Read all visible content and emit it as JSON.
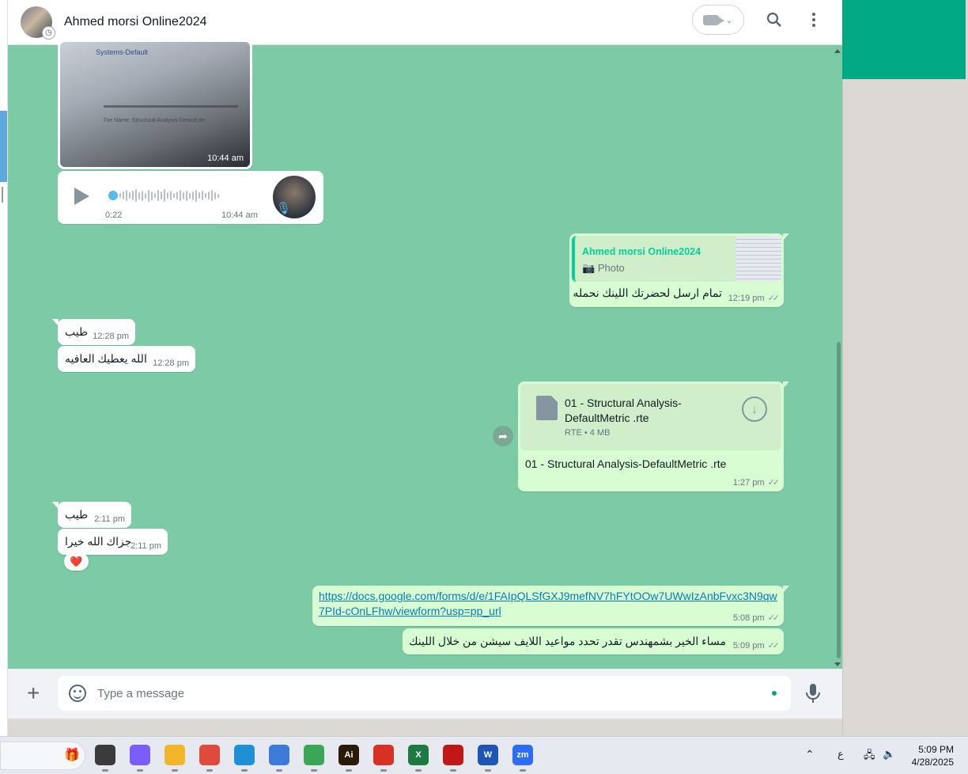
{
  "header": {
    "contact_name": "Ahmed morsi Online2024"
  },
  "messages": {
    "photo": {
      "time": "10:44 am",
      "screen_label": "Systems-Default",
      "screen_text": "File Name:  Structural Analysis-Default.rte"
    },
    "voice": {
      "duration": "0:22",
      "time": "10:44 am"
    },
    "reply": {
      "quoted_name": "Ahmed morsi Online2024",
      "quoted_type": "Photo",
      "text": "تمام ارسل لحضرتك اللينك نحمله",
      "time": "12:19 pm"
    },
    "in1": {
      "text": "طيب",
      "time": "12:28 pm"
    },
    "in2": {
      "text": "الله يعطيك العافيه",
      "time": "12:28 pm"
    },
    "file": {
      "name": "01 - Structural Analysis-DefaultMetric .rte",
      "meta": "RTE • 4 MB",
      "caption": "01 - Structural Analysis-DefaultMetric .rte",
      "time": "1:27 pm"
    },
    "in3": {
      "text": "طيب",
      "time": "2:11 pm"
    },
    "in4": {
      "text": "جزاك الله خيرا",
      "time": "2:11 pm",
      "reaction": "❤️"
    },
    "link": {
      "url": "https://docs.google.com/forms/d/e/1FAIpQLSfGXJ9mefNV7hFYtOOw7UWwIzAnbFvxc3N9qw7PId-cOnLFhw/viewform?usp=pp_url",
      "time": "5:08 pm"
    },
    "last": {
      "text": "مساء الخير بشمهندس تقدر تحدد مواعيد اللايف سيشن من خلال اللينك",
      "time": "5:09 pm"
    },
    "ticks": "✓✓"
  },
  "composer": {
    "placeholder": "Type a message"
  },
  "taskbar": {
    "time": "5:09 PM",
    "date": "4/28/2025",
    "lang": "ع",
    "apps": [
      {
        "icon": "task-view-icon",
        "color": "#3b3b3b"
      },
      {
        "icon": "copilot-icon",
        "color": "#7a5cff"
      },
      {
        "icon": "file-explorer-icon",
        "color": "#f2b52b"
      },
      {
        "icon": "snipping-tool-icon",
        "color": "#e04a3a"
      },
      {
        "icon": "edge-icon",
        "color": "#1f8fd6"
      },
      {
        "icon": "notepad-icon",
        "color": "#3d7bd8"
      },
      {
        "icon": "chrome-icon",
        "color": "#3aa757"
      },
      {
        "icon": "illustrator-icon",
        "color": "#2a1a07",
        "label": "Ai"
      },
      {
        "icon": "chrome-profile-icon",
        "color": "#d93025"
      },
      {
        "icon": "excel-icon",
        "color": "#1d7a43",
        "label": "X"
      },
      {
        "icon": "mcafee-icon",
        "color": "#c01818"
      },
      {
        "icon": "word-icon",
        "color": "#1e56b8",
        "label": "W"
      },
      {
        "icon": "zoom-icon",
        "color": "#2d6cf5",
        "label": "zm"
      }
    ]
  },
  "colors": {
    "chat_bg": "#7dcba6",
    "outgoing": "#d9fdd3",
    "accent": "#00a884",
    "link": "#027eb5"
  }
}
